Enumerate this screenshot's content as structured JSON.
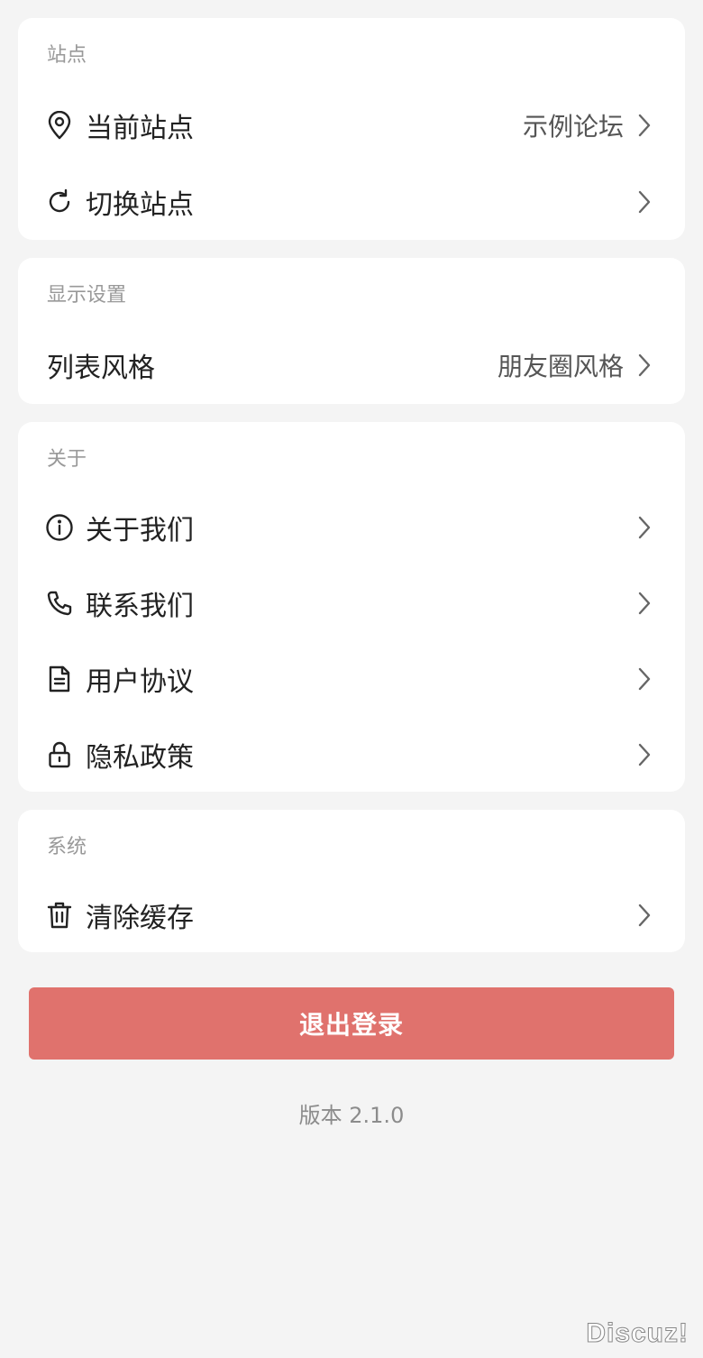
{
  "sections": {
    "site": {
      "title": "站点",
      "current_site_label": "当前站点",
      "current_site_value": "示例论坛",
      "switch_site_label": "切换站点"
    },
    "display": {
      "title": "显示设置",
      "list_style_label": "列表风格",
      "list_style_value": "朋友圈风格"
    },
    "about": {
      "title": "关于",
      "about_us_label": "关于我们",
      "contact_us_label": "联系我们",
      "user_agreement_label": "用户协议",
      "privacy_policy_label": "隐私政策"
    },
    "system": {
      "title": "系统",
      "clear_cache_label": "清除缓存"
    }
  },
  "logout_label": "退出登录",
  "version_text": "版本 2.1.0",
  "watermark_text": "Discuz!",
  "icons": {
    "current_site": "location-pin-icon",
    "switch_site": "refresh-icon",
    "about_us": "info-circle-icon",
    "contact_us": "phone-icon",
    "user_agreement": "document-icon",
    "privacy_policy": "lock-icon",
    "clear_cache": "trash-icon",
    "chevron": "chevron-right-icon"
  },
  "colors": {
    "background": "#f4f4f4",
    "card": "#ffffff",
    "logout_button": "#e0726d",
    "section_title": "#999999"
  }
}
